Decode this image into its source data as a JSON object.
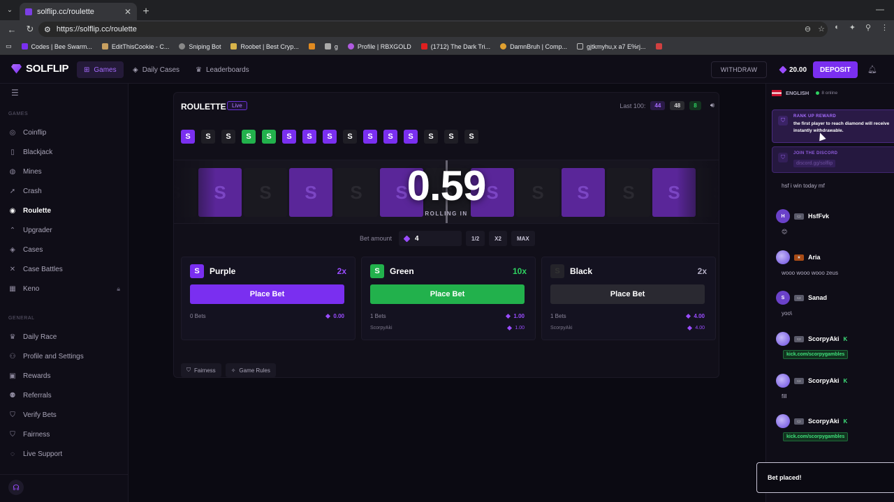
{
  "browser": {
    "tab_title": "solflip.cc/roulette",
    "url": "https://solflip.cc/roulette",
    "bookmarks": [
      "Codes | Bee Swarm...",
      "EditThisCookie - C...",
      "Sniping Bot",
      "Roobet | Best Cryp...",
      "g",
      "Profile | RBXGOLD",
      "(1712) The Dark Tri...",
      "DamnBruh | Comp...",
      "gjtkmyhu,x a7 E%rj..."
    ]
  },
  "header": {
    "logo_text": "SOLFLIP",
    "nav": [
      "Games",
      "Daily Cases",
      "Leaderboards"
    ],
    "withdraw": "WITHDRAW",
    "balance": "20.00",
    "deposit": "DEPOSIT"
  },
  "sidebar": {
    "games_heading": "GAMES",
    "games": [
      "Coinflip",
      "Blackjack",
      "Mines",
      "Crash",
      "Roulette",
      "Upgrader",
      "Cases",
      "Case Battles",
      "Keno"
    ],
    "general_heading": "GENERAL",
    "general": [
      "Daily Race",
      "Profile and Settings",
      "Rewards",
      "Referrals",
      "Verify Bets",
      "Fairness",
      "Live Support"
    ]
  },
  "game": {
    "title": "ROULETTE",
    "live": "Live",
    "last_label": "Last 100:",
    "last_purple": "44",
    "last_black": "48",
    "last_green": "8",
    "history": [
      "purple",
      "black",
      "black",
      "green",
      "green",
      "purple",
      "purple",
      "purple",
      "black",
      "purple",
      "purple",
      "purple",
      "black",
      "black",
      "black"
    ],
    "history_glyph": "S",
    "countdown": "0.59",
    "rolling_label": "ROLLING IN",
    "bet_label": "Bet amount",
    "bet_value": "4",
    "half": "1/2",
    "double": "X2",
    "max": "MAX",
    "cards": [
      {
        "name": "Purple",
        "mult": "2x",
        "button": "Place Bet",
        "bets": "0 Bets",
        "total": "0.00",
        "user": "",
        "user_amt": ""
      },
      {
        "name": "Green",
        "mult": "10x",
        "button": "Place Bet",
        "bets": "1 Bets",
        "total": "1.00",
        "user": "ScorpyAki",
        "user_amt": "1.00"
      },
      {
        "name": "Black",
        "mult": "2x",
        "button": "Place Bet",
        "bets": "1 Bets",
        "total": "4.00",
        "user": "ScorpyAki",
        "user_amt": "4.00"
      }
    ],
    "fairness": "Fairness",
    "rules": "Game Rules"
  },
  "chat": {
    "language": "ENGLISH",
    "online": "8 online",
    "promo1_title": "RANK UP REWARD",
    "promo1_text": "the first player to reach diamond will receive instantly withdrawable.",
    "promo2_title": "JOIN THE DISCORD",
    "promo2_link": "discord.gg/solflip",
    "messages": [
      {
        "user": "",
        "text": "hsf i win today mf"
      },
      {
        "user": "HsfFvk",
        "text": "😊"
      },
      {
        "user": "Aria",
        "text": "wooo wooo wooo zeus"
      },
      {
        "user": "Sanad",
        "text": "yoo\\"
      },
      {
        "user": "ScorpyAki",
        "text": "kick.com/scorpygambles"
      },
      {
        "user": "ScorpyAki",
        "text": "fill"
      },
      {
        "user": "ScorpyAki",
        "text": "kick.com/scorpygambles"
      }
    ],
    "kick_badge": "K",
    "avatar_h": "H",
    "avatar_s": "S"
  },
  "toast": "Bet placed!",
  "colors": {
    "purple": "#7a2ff0",
    "green": "#22b14c",
    "black": "#1f1e25",
    "accent": "#9a4cff"
  }
}
